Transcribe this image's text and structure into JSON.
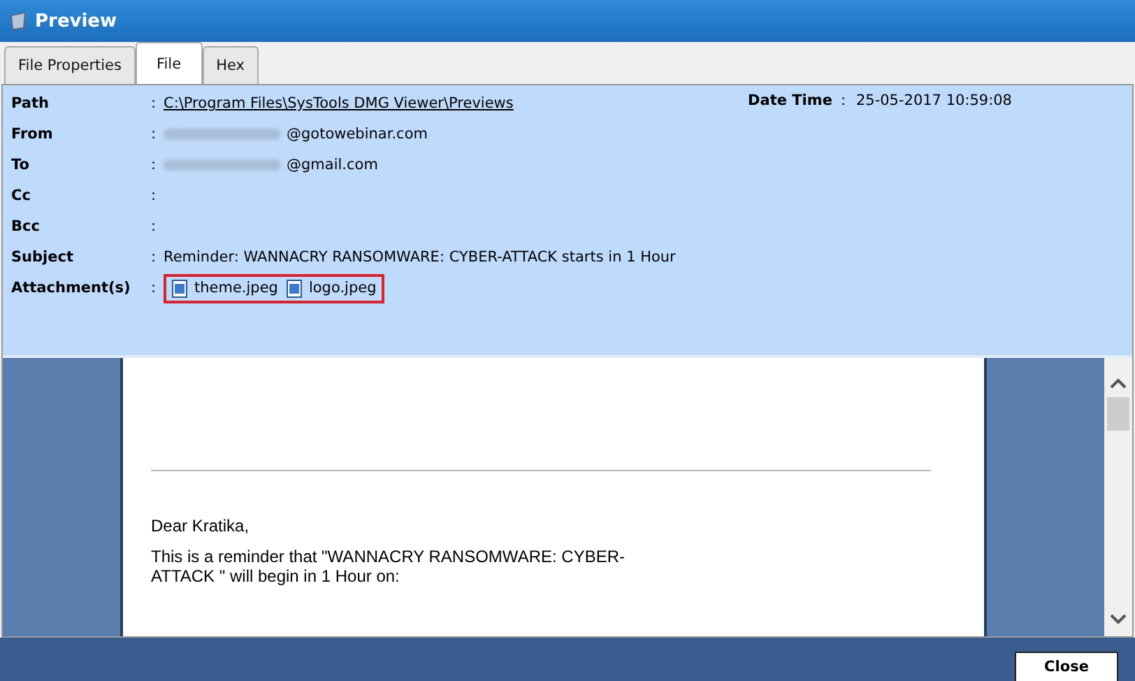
{
  "window": {
    "title": "Preview"
  },
  "tabs": [
    {
      "label": "File Properties",
      "selected": false
    },
    {
      "label": "File",
      "selected": true
    },
    {
      "label": "Hex",
      "selected": false
    }
  ],
  "header": {
    "fields": [
      {
        "label": "Path",
        "separator": ":",
        "kind": "link",
        "value": "C:\\Program Files\\SysTools DMG Viewer\\Previews"
      },
      {
        "label": "From",
        "separator": ":",
        "kind": "redacted",
        "value": "@gotowebinar.com"
      },
      {
        "label": "To",
        "separator": ":",
        "kind": "redacted",
        "value": "@gmail.com"
      },
      {
        "label": "Cc",
        "separator": ":",
        "kind": "text"
      },
      {
        "label": "Bcc",
        "separator": ":",
        "kind": "text"
      },
      {
        "label": "Subject",
        "separator": ":",
        "kind": "text",
        "value": "Reminder: WANNACRY RANSOMWARE: CYBER-ATTACK  starts in 1 Hour"
      },
      {
        "label": "Attachment(s)",
        "separator": ":",
        "kind": "attachments",
        "highlighted": true,
        "files": [
          "theme.jpeg",
          "logo.jpeg"
        ]
      }
    ],
    "date": {
      "label": "Date Time",
      "separator": ":",
      "value": "25-05-2017 10:59:08"
    }
  },
  "body": {
    "paragraphs": [
      "Dear Kratika,",
      "This is a reminder that \"WANNACRY RANSOMWARE: CYBER-ATTACK \" will begin in 1 Hour on:"
    ]
  },
  "buttons": [
    {
      "label": "Close"
    }
  ]
}
